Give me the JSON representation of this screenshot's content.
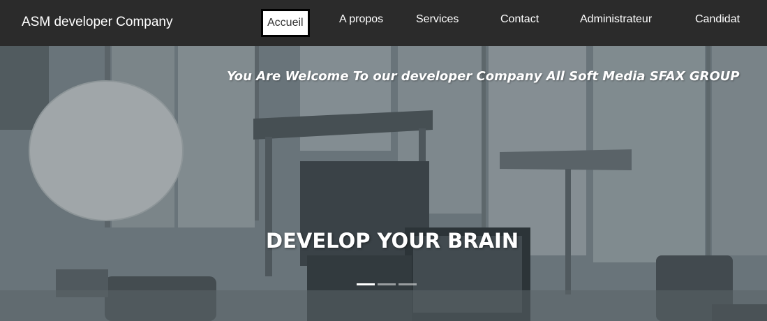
{
  "navbar": {
    "brand": "ASM developer Company",
    "items": [
      {
        "label": "Accueil",
        "active": true
      },
      {
        "label": "A propos"
      },
      {
        "label": "Services"
      },
      {
        "label": "Contact"
      },
      {
        "label": "Administrateur"
      },
      {
        "label": "Candidat"
      }
    ]
  },
  "hero": {
    "welcome": "You Are Welcome To our developer Company All Soft Media SFAX GROUP",
    "headline": "DEVELOP YOUR BRAIN",
    "carousel": {
      "slides": 3,
      "active_slide": 1
    }
  }
}
